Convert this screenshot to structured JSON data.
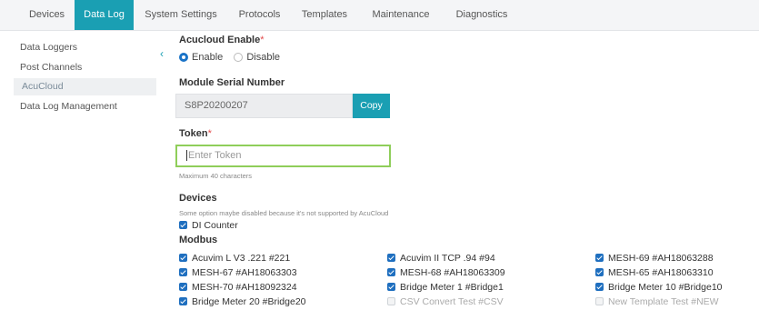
{
  "tabs": [
    {
      "label": "Devices"
    },
    {
      "label": "Data Log"
    },
    {
      "label": "System Settings"
    },
    {
      "label": "Protocols"
    },
    {
      "label": "Templates"
    },
    {
      "label": "Maintenance"
    },
    {
      "label": "Diagnostics"
    }
  ],
  "sidebar": {
    "items": [
      {
        "label": "Data Loggers"
      },
      {
        "label": "Post Channels"
      },
      {
        "label": "AcuCloud"
      },
      {
        "label": "Data Log Management"
      }
    ]
  },
  "acucloud": {
    "label": "Acucloud Enable",
    "required": "*",
    "options": [
      {
        "label": "Enable",
        "selected": true
      },
      {
        "label": "Disable",
        "selected": false
      }
    ]
  },
  "serial": {
    "label": "Module Serial Number",
    "value": "S8P20200207",
    "copy_label": "Copy"
  },
  "token": {
    "label": "Token",
    "required": "*",
    "placeholder": "Enter Token",
    "hint": "Maximum 40 characters"
  },
  "devices": {
    "label": "Devices",
    "note": "Some option maybe disabled because it's not supported by AcuCloud",
    "di_counter": {
      "label": "DI Counter",
      "checked": true
    },
    "modbus_label": "Modbus",
    "modbus": [
      [
        {
          "label": "Acuvim L V3 .221 #221",
          "checked": true
        },
        {
          "label": "MESH-67 #AH18063303",
          "checked": true
        },
        {
          "label": "MESH-70 #AH18092324",
          "checked": true
        },
        {
          "label": "Bridge Meter 20 #Bridge20",
          "checked": true
        }
      ],
      [
        {
          "label": "Acuvim II TCP .94 #94",
          "checked": true
        },
        {
          "label": "MESH-68 #AH18063309",
          "checked": true
        },
        {
          "label": "Bridge Meter 1 #Bridge1",
          "checked": true
        },
        {
          "label": "CSV Convert Test #CSV",
          "checked": false
        }
      ],
      [
        {
          "label": "MESH-69 #AH18063288",
          "checked": true
        },
        {
          "label": "MESH-65 #AH18063310",
          "checked": true
        },
        {
          "label": "Bridge Meter 10 #Bridge10",
          "checked": true
        },
        {
          "label": "New Template Test #NEW",
          "checked": false
        }
      ]
    ]
  },
  "colors": {
    "accent": "#1a9fb3",
    "checkbox": "#1f6fbf",
    "required": "#e24b4b",
    "focus_border": "#8fce5a"
  }
}
